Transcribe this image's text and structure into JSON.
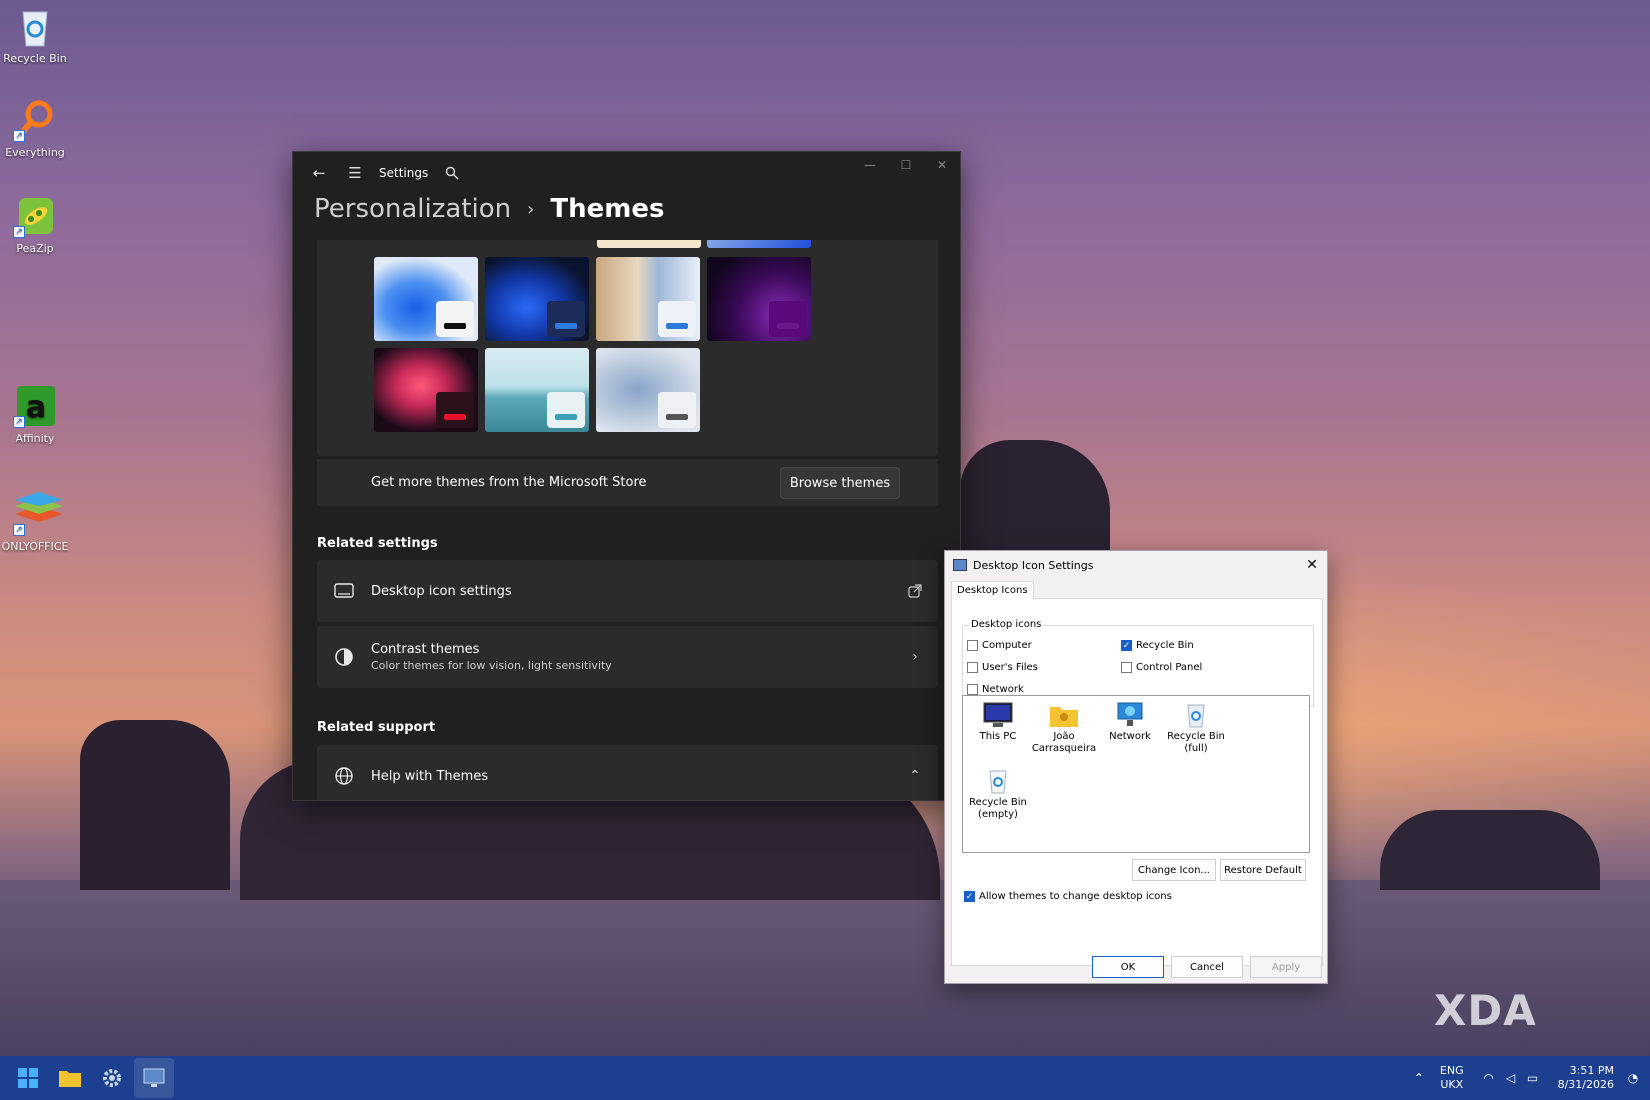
{
  "desktop": {
    "icons": [
      {
        "label": "Recycle Bin"
      },
      {
        "label": "Everything"
      },
      {
        "label": "PeaZip"
      },
      {
        "label": "Affinity"
      },
      {
        "label": "ONLYOFFICE"
      }
    ]
  },
  "settings": {
    "app_title": "Settings",
    "breadcrumb_parent": "Personalization",
    "breadcrumb_separator": "›",
    "breadcrumb_current": "Themes",
    "store_text": "Get more themes from the Microsoft Store",
    "browse_button": "Browse themes",
    "related_settings_title": "Related settings",
    "desktop_icon_settings": "Desktop icon settings",
    "contrast_title": "Contrast themes",
    "contrast_sub": "Color themes for low vision, light sensitivity",
    "related_support_title": "Related support",
    "help_themes": "Help with Themes"
  },
  "dialog": {
    "title": "Desktop Icon Settings",
    "tab": "Desktop Icons",
    "group_label": "Desktop icons",
    "checkboxes": {
      "computer": {
        "label": "Computer",
        "checked": false
      },
      "recycle_bin": {
        "label": "Recycle Bin",
        "checked": true
      },
      "users_files": {
        "label": "User's Files",
        "checked": false
      },
      "control_panel": {
        "label": "Control Panel",
        "checked": false
      },
      "network": {
        "label": "Network",
        "checked": false
      }
    },
    "icons": [
      {
        "label": "This PC"
      },
      {
        "label": "João Carrasqueira"
      },
      {
        "label": "Network"
      },
      {
        "label": "Recycle Bin (full)"
      },
      {
        "label": "Recycle Bin (empty)"
      }
    ],
    "change_icon": "Change Icon...",
    "restore_default": "Restore Default",
    "allow_themes": "Allow themes to change desktop icons",
    "allow_themes_checked": true,
    "ok": "OK",
    "cancel": "Cancel",
    "apply": "Apply"
  },
  "taskbar": {
    "lang_top": "ENG",
    "lang_bottom": "UKX",
    "time": "3:51 PM",
    "date": "8/31/2026"
  },
  "watermark": "XDA"
}
